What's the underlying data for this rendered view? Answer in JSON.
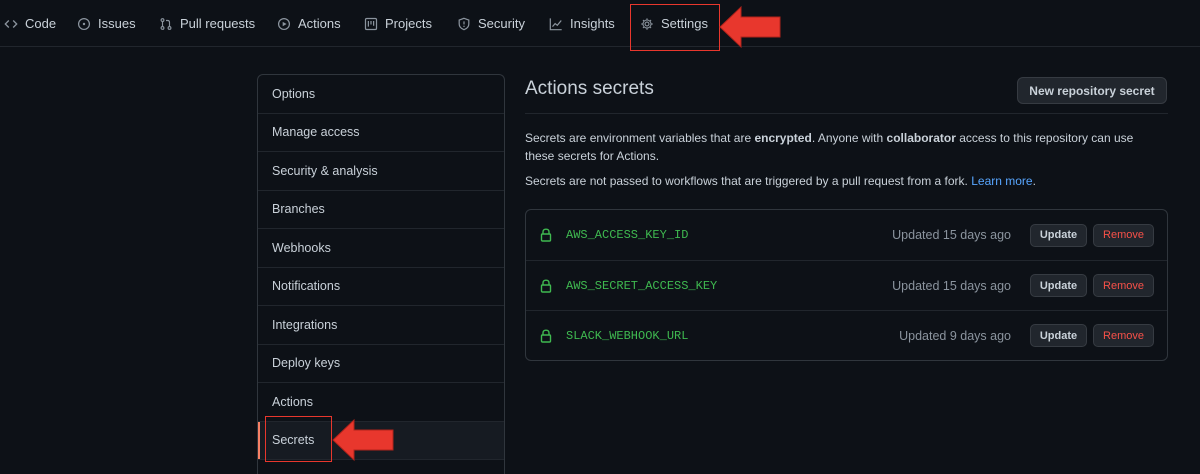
{
  "tabs": {
    "code": "Code",
    "issues": "Issues",
    "pulls": "Pull requests",
    "actions": "Actions",
    "projects": "Projects",
    "security": "Security",
    "insights": "Insights",
    "settings": "Settings"
  },
  "sidebar": {
    "items": [
      {
        "label": "Options"
      },
      {
        "label": "Manage access"
      },
      {
        "label": "Security & analysis"
      },
      {
        "label": "Branches"
      },
      {
        "label": "Webhooks"
      },
      {
        "label": "Notifications"
      },
      {
        "label": "Integrations"
      },
      {
        "label": "Deploy keys"
      },
      {
        "label": "Actions"
      },
      {
        "label": "Secrets"
      }
    ]
  },
  "main": {
    "title": "Actions secrets",
    "new_secret_button": "New repository secret",
    "description": {
      "p1_a": "Secrets are environment variables that are ",
      "p1_b": "encrypted",
      "p1_c": ". Anyone with ",
      "p1_d": "collaborator",
      "p1_e": " access to this repository can use these secrets for Actions.",
      "p2_a": "Secrets are not passed to workflows that are triggered by a pull request from a fork. ",
      "p2_link": "Learn more",
      "p2_end": "."
    },
    "secrets": [
      {
        "name": "AWS_ACCESS_KEY_ID",
        "updated": "Updated 15 days ago",
        "update": "Update",
        "remove": "Remove"
      },
      {
        "name": "AWS_SECRET_ACCESS_KEY",
        "updated": "Updated 15 days ago",
        "update": "Update",
        "remove": "Remove"
      },
      {
        "name": "SLACK_WEBHOOK_URL",
        "updated": "Updated 9 days ago",
        "update": "Update",
        "remove": "Remove"
      }
    ]
  },
  "colors": {
    "background": "#0d1117",
    "accent_red": "#e8372d",
    "secret_green": "#3fb950",
    "link_blue": "#58a6ff",
    "remove_red": "#f85149"
  },
  "icons": {
    "code": "code-icon",
    "issues": "issue-circle-icon",
    "pulls": "pull-request-icon",
    "actions": "play-icon",
    "projects": "project-board-icon",
    "security": "shield-icon",
    "insights": "graph-icon",
    "settings": "gear-icon",
    "secret": "lock-icon",
    "annotation": "red-arrow-icon"
  }
}
